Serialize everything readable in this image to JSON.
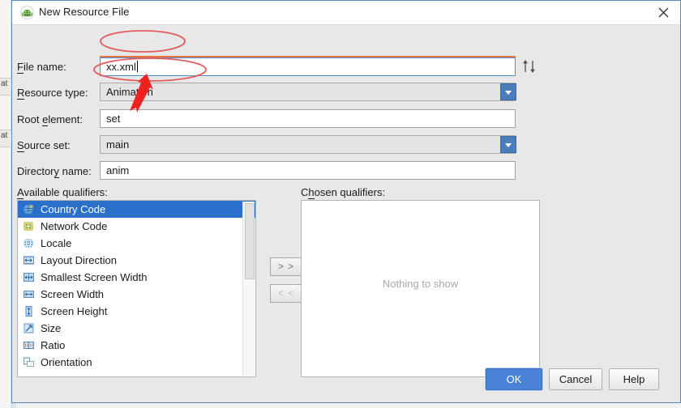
{
  "window": {
    "title": "New Resource File",
    "icon": "android-robot-icon",
    "close_label": "✕"
  },
  "form": {
    "file_name": {
      "label": "File name:",
      "mnemonic": "F",
      "value": "xx.xml",
      "sort_icon": "sort-up-down-icon"
    },
    "resource_type": {
      "label": "Resource type:",
      "mnemonic": "R",
      "value": "Animation"
    },
    "root_element": {
      "label": "Root element:",
      "mnemonic": "e",
      "value": "set"
    },
    "source_set": {
      "label": "Source set:",
      "mnemonic": "S",
      "value": "main"
    },
    "directory_name": {
      "label": "Directory name:",
      "mnemonic": "y",
      "value": "anim"
    }
  },
  "available": {
    "label": "Available qualifiers:",
    "mnemonic": "A",
    "items": [
      {
        "label": "Country Code",
        "icon": "country-code-icon",
        "selected": true
      },
      {
        "label": "Network Code",
        "icon": "network-code-icon",
        "selected": false
      },
      {
        "label": "Locale",
        "icon": "locale-globe-icon",
        "selected": false
      },
      {
        "label": "Layout Direction",
        "icon": "layout-direction-icon",
        "selected": false
      },
      {
        "label": "Smallest Screen Width",
        "icon": "smallest-screen-width-icon",
        "selected": false
      },
      {
        "label": "Screen Width",
        "icon": "screen-width-icon",
        "selected": false
      },
      {
        "label": "Screen Height",
        "icon": "screen-height-icon",
        "selected": false
      },
      {
        "label": "Size",
        "icon": "size-icon",
        "selected": false
      },
      {
        "label": "Ratio",
        "icon": "ratio-icon",
        "selected": false
      },
      {
        "label": "Orientation",
        "icon": "orientation-icon",
        "selected": false
      }
    ]
  },
  "chosen": {
    "label": "Chosen qualifiers:",
    "mnemonic": "h",
    "empty_text": "Nothing to show"
  },
  "transfer": {
    "add_label": "> >",
    "remove_label": "< <"
  },
  "buttons": {
    "ok": "OK",
    "cancel": "Cancel",
    "help": "Help"
  },
  "background": {
    "strip_1": "at",
    "strip_2": "at"
  },
  "colors": {
    "accent_blue": "#4a82d8",
    "selection_blue": "#2a6fc9",
    "dialog_bg": "#e8e8e8",
    "annotation_red": "#e45b5b",
    "focus_orange": "#e8743b"
  }
}
